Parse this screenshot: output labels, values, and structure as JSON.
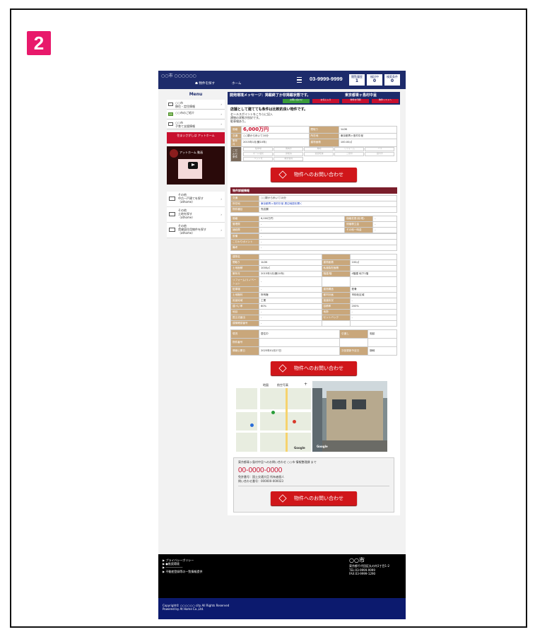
{
  "step_badge": "2",
  "header": {
    "brand": "○○市 ○○○○○○",
    "nav1": "☗ 物件を探す",
    "nav2": "ホーム",
    "tel": "03-9999-9999",
    "mini_buttons": [
      {
        "label": "閲覧履歴",
        "count": "1"
      },
      {
        "label": "検討中",
        "count": "0"
      },
      {
        "label": "検索条件",
        "count": "0"
      }
    ]
  },
  "sidebar": {
    "menu_title": "Menu",
    "items": [
      {
        "label": "○○市\n移住・定住情報"
      },
      {
        "label": "○○市のご紹介"
      },
      {
        "label": "○○市\n子育て支援情報"
      }
    ],
    "red_box": "住まいさがしは アットホーム",
    "video_title": "アットホーム 動画",
    "links": [
      {
        "label": "その他\n中古一戸建てを探す\n（athome）"
      },
      {
        "label": "その他\n土地を探す\n（athome）"
      },
      {
        "label": "その他\n賃貸居住用物件を探す\n（athome）"
      }
    ]
  },
  "alert": {
    "message": "開発環境メッセージ：掲載終了か非掲載状態です。",
    "company": "東京都青ヶ島村中呈",
    "buttons": [
      "お問い合わせ",
      "お気に入り",
      "物件を印刷",
      "物件リストへ"
    ]
  },
  "intro": {
    "headline": "店舗として建てても条件は比較的良い物件です。",
    "lines": [
      "セールスポイントをこちらに記入",
      "建物の状態が良好です。",
      "駐車場あり。"
    ]
  },
  "summary": {
    "rows": [
      {
        "k1": "価格",
        "v1": "6,000万円",
        "k2": "間取り",
        "v2": "1LDK"
      },
      {
        "k1": "交通",
        "v1": "○○駅から歩いて10分",
        "k2": "所在地",
        "v2": "東京都青ヶ島村中呈"
      },
      {
        "k1": "築年月",
        "v1": "2015年1月(築10年)",
        "k2": "建物面積",
        "v2": "100.00㎡"
      }
    ],
    "tags_label": "こだわり条件",
    "tags": [
      "駐車場",
      "南向き",
      "角地",
      "リフォーム",
      "バス",
      "オール電化",
      "床暖房",
      "浴室乾燥",
      "二世帯",
      "庭付き",
      "ペット可",
      "眺望良好"
    ]
  },
  "cta_label": "物件へのお問い合わせ",
  "detail": {
    "title": "物件詳細情報",
    "rows1": [
      {
        "k": "交通",
        "v": "○○駅から歩いて10分"
      },
      {
        "k": "所在地",
        "v": "東京都青ヶ島村中呈 周辺地図を開く"
      },
      {
        "k": "物件種目",
        "v": "売店舗"
      }
    ],
    "rows2": [
      {
        "k1": "価格",
        "v1": "6,000万円",
        "k2": "価格変更(前/現)",
        "v2": "-"
      },
      {
        "k1": "管理費",
        "v1": "-",
        "k2": "修繕積立金",
        "v2": "-"
      },
      {
        "k1": "諸経費",
        "v1": "-",
        "k2": "その他一時金",
        "v2": "-"
      }
    ],
    "rows3": [
      {
        "k": "設備",
        "v": "-"
      },
      {
        "k": "こだわりポイント",
        "v": "-"
      },
      {
        "k": "備考",
        "v": "-"
      }
    ],
    "rows4": [
      {
        "k1": "建物名",
        "v1": "",
        "k2": "",
        "v2": ""
      },
      {
        "k1": "間取り",
        "v1": "1LDK",
        "k2": "建物面積",
        "v2": "100㎡"
      },
      {
        "k1": "土地面積",
        "v1": "1000㎡",
        "k2": "私道負担面積",
        "v2": ""
      },
      {
        "k1": "築年月",
        "v1": "2015年1月(築10年)",
        "k2": "階建/階",
        "v2": "4階建 地下1階"
      },
      {
        "k1": "リフォーム/リノベーション",
        "v1": "-",
        "k2": "",
        "v2": ""
      },
      {
        "k1": "駐車場",
        "v1": "-",
        "k2": "建物構造",
        "v2": "鉄骨"
      },
      {
        "k1": "土地権利",
        "v1": "所有権",
        "k2": "都市計画",
        "v2": "市街化区域"
      },
      {
        "k1": "用途地域",
        "v1": "工業",
        "k2": "接道状況",
        "v2": "-"
      },
      {
        "k1": "建ぺい率",
        "v1": "60%",
        "k2": "容積率",
        "v2": "200%"
      },
      {
        "k1": "地目",
        "v1": "-",
        "k2": "地勢",
        "v2": "-"
      },
      {
        "k1": "国土法届出",
        "v1": "-",
        "k2": "セットバック",
        "v2": "-"
      },
      {
        "k1": "建築確認番号",
        "v1": "-",
        "k2": "",
        "v2": ""
      }
    ],
    "rows5": [
      {
        "k1": "現況",
        "v1": "居住中",
        "k2": "引渡し",
        "v2": "相談"
      },
      {
        "k1": "物件番号",
        "v1": "",
        "k2": "",
        "v2": ""
      },
      {
        "k1": "情報公開日",
        "v1": "2025年01月27日",
        "k2": "次回更新予定日",
        "v2": "随時"
      }
    ]
  },
  "map": {
    "tab1": "地図",
    "tab2": "航空写真",
    "credit": "Google"
  },
  "contact": {
    "lead": "東京都青ヶ島村中呈へのお問い合わせ ○○市 情報整理課 まで",
    "tel": "00-0000-0000",
    "line1": "免許番号：国土交通大臣 所有者個人",
    "line2": "問い合わせ番号：000000-000023"
  },
  "footer": {
    "links": [
      "▶ プライバシーポリシー",
      "▶ ●推奨環境",
      "▶ ――――――",
      "▶ 不動産登録等の一覧情報提供"
    ],
    "city": "○○市",
    "addr": "東京都千代田区丸の内1丁目1-2",
    "tel": "TEL:03-9999-9999",
    "fax": "FAX:03-9999-1290",
    "copyright": "Copyright© ○○○○○○ city All Rights Reserved",
    "powered": "Powered by At Home Co.,Ltd."
  }
}
